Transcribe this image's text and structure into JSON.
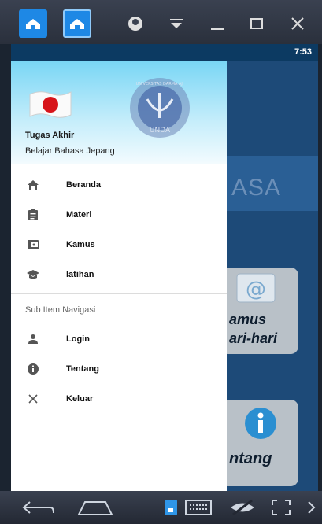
{
  "status_bar": {
    "time": "7:53"
  },
  "drawer": {
    "header": {
      "title": "Tugas Akhir",
      "subtitle": "Belajar Bahasa Jepang",
      "logo_text": "UNIVERSITAS DARMA AJI",
      "logo_short": "UNDA"
    },
    "items": [
      {
        "label": "Beranda",
        "icon": "home-icon"
      },
      {
        "label": "Materi",
        "icon": "clipboard-icon"
      },
      {
        "label": "Kamus",
        "icon": "wallet-icon"
      },
      {
        "label": "latihan",
        "icon": "school-icon"
      }
    ],
    "section_title": "Sub Item Navigasi",
    "sub_items": [
      {
        "label": "Login",
        "icon": "person-icon"
      },
      {
        "label": "Tentang",
        "icon": "info-icon"
      },
      {
        "label": "Keluar",
        "icon": "close-icon"
      }
    ]
  },
  "background_app": {
    "banner_text": "ASA",
    "card1_line1": "amus",
    "card1_line2": "ari-hari",
    "card2_text": "ntang"
  },
  "colors": {
    "accent": "#1e88e5",
    "header_top": "#79d6f5",
    "app_bg": "#1d4a78"
  }
}
